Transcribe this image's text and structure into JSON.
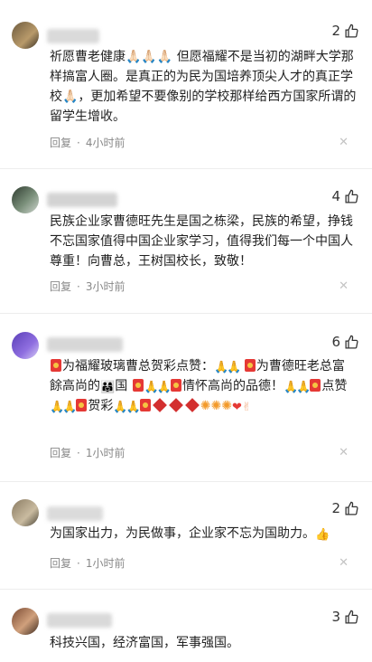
{
  "comments": [
    {
      "likes": "2",
      "text": "祈愿曹老健康🙏🏻🙏🏻🙏🏻 但愿福耀不是当初的湖畔大学那样搞富人圈。是真正的为民为国培养顶尖人才的真正学校🙏🏻，更加希望不要像别的学校那样给西方国家所谓的留学生增收。",
      "reply_label": "回复",
      "time": "4小时前"
    },
    {
      "likes": "4",
      "text": "民族企业家曹德旺先生是国之栋梁，民族的希望，挣钱不忘国家值得中国企业家学习，值得我们每一个中国人尊重！向曹总，王树国校长，致敬！",
      "reply_label": "回复",
      "time": "3小时前"
    },
    {
      "likes": "6",
      "seg1": "为福耀玻璃曹总贺彩点赞：",
      "seg2": "为曹德旺老总富餘高尚的",
      "seg3": "国",
      "seg4": "情怀高尚的品德！",
      "seg5": "点赞",
      "seg6": "贺彩",
      "reply_label": "回复",
      "time": "1小时前"
    },
    {
      "likes": "2",
      "text": "为国家出力，为民做事，企业家不忘为国助力。",
      "reply_label": "回复",
      "time": "1小时前"
    },
    {
      "likes": "3",
      "text": "科技兴国，经济富国，军事强国。"
    }
  ],
  "icons": {
    "like": "thumbs-up-icon",
    "close": "close-icon"
  },
  "colors": {
    "pray": "#f2b48e",
    "red": "#e53935",
    "meta": "#888888"
  }
}
